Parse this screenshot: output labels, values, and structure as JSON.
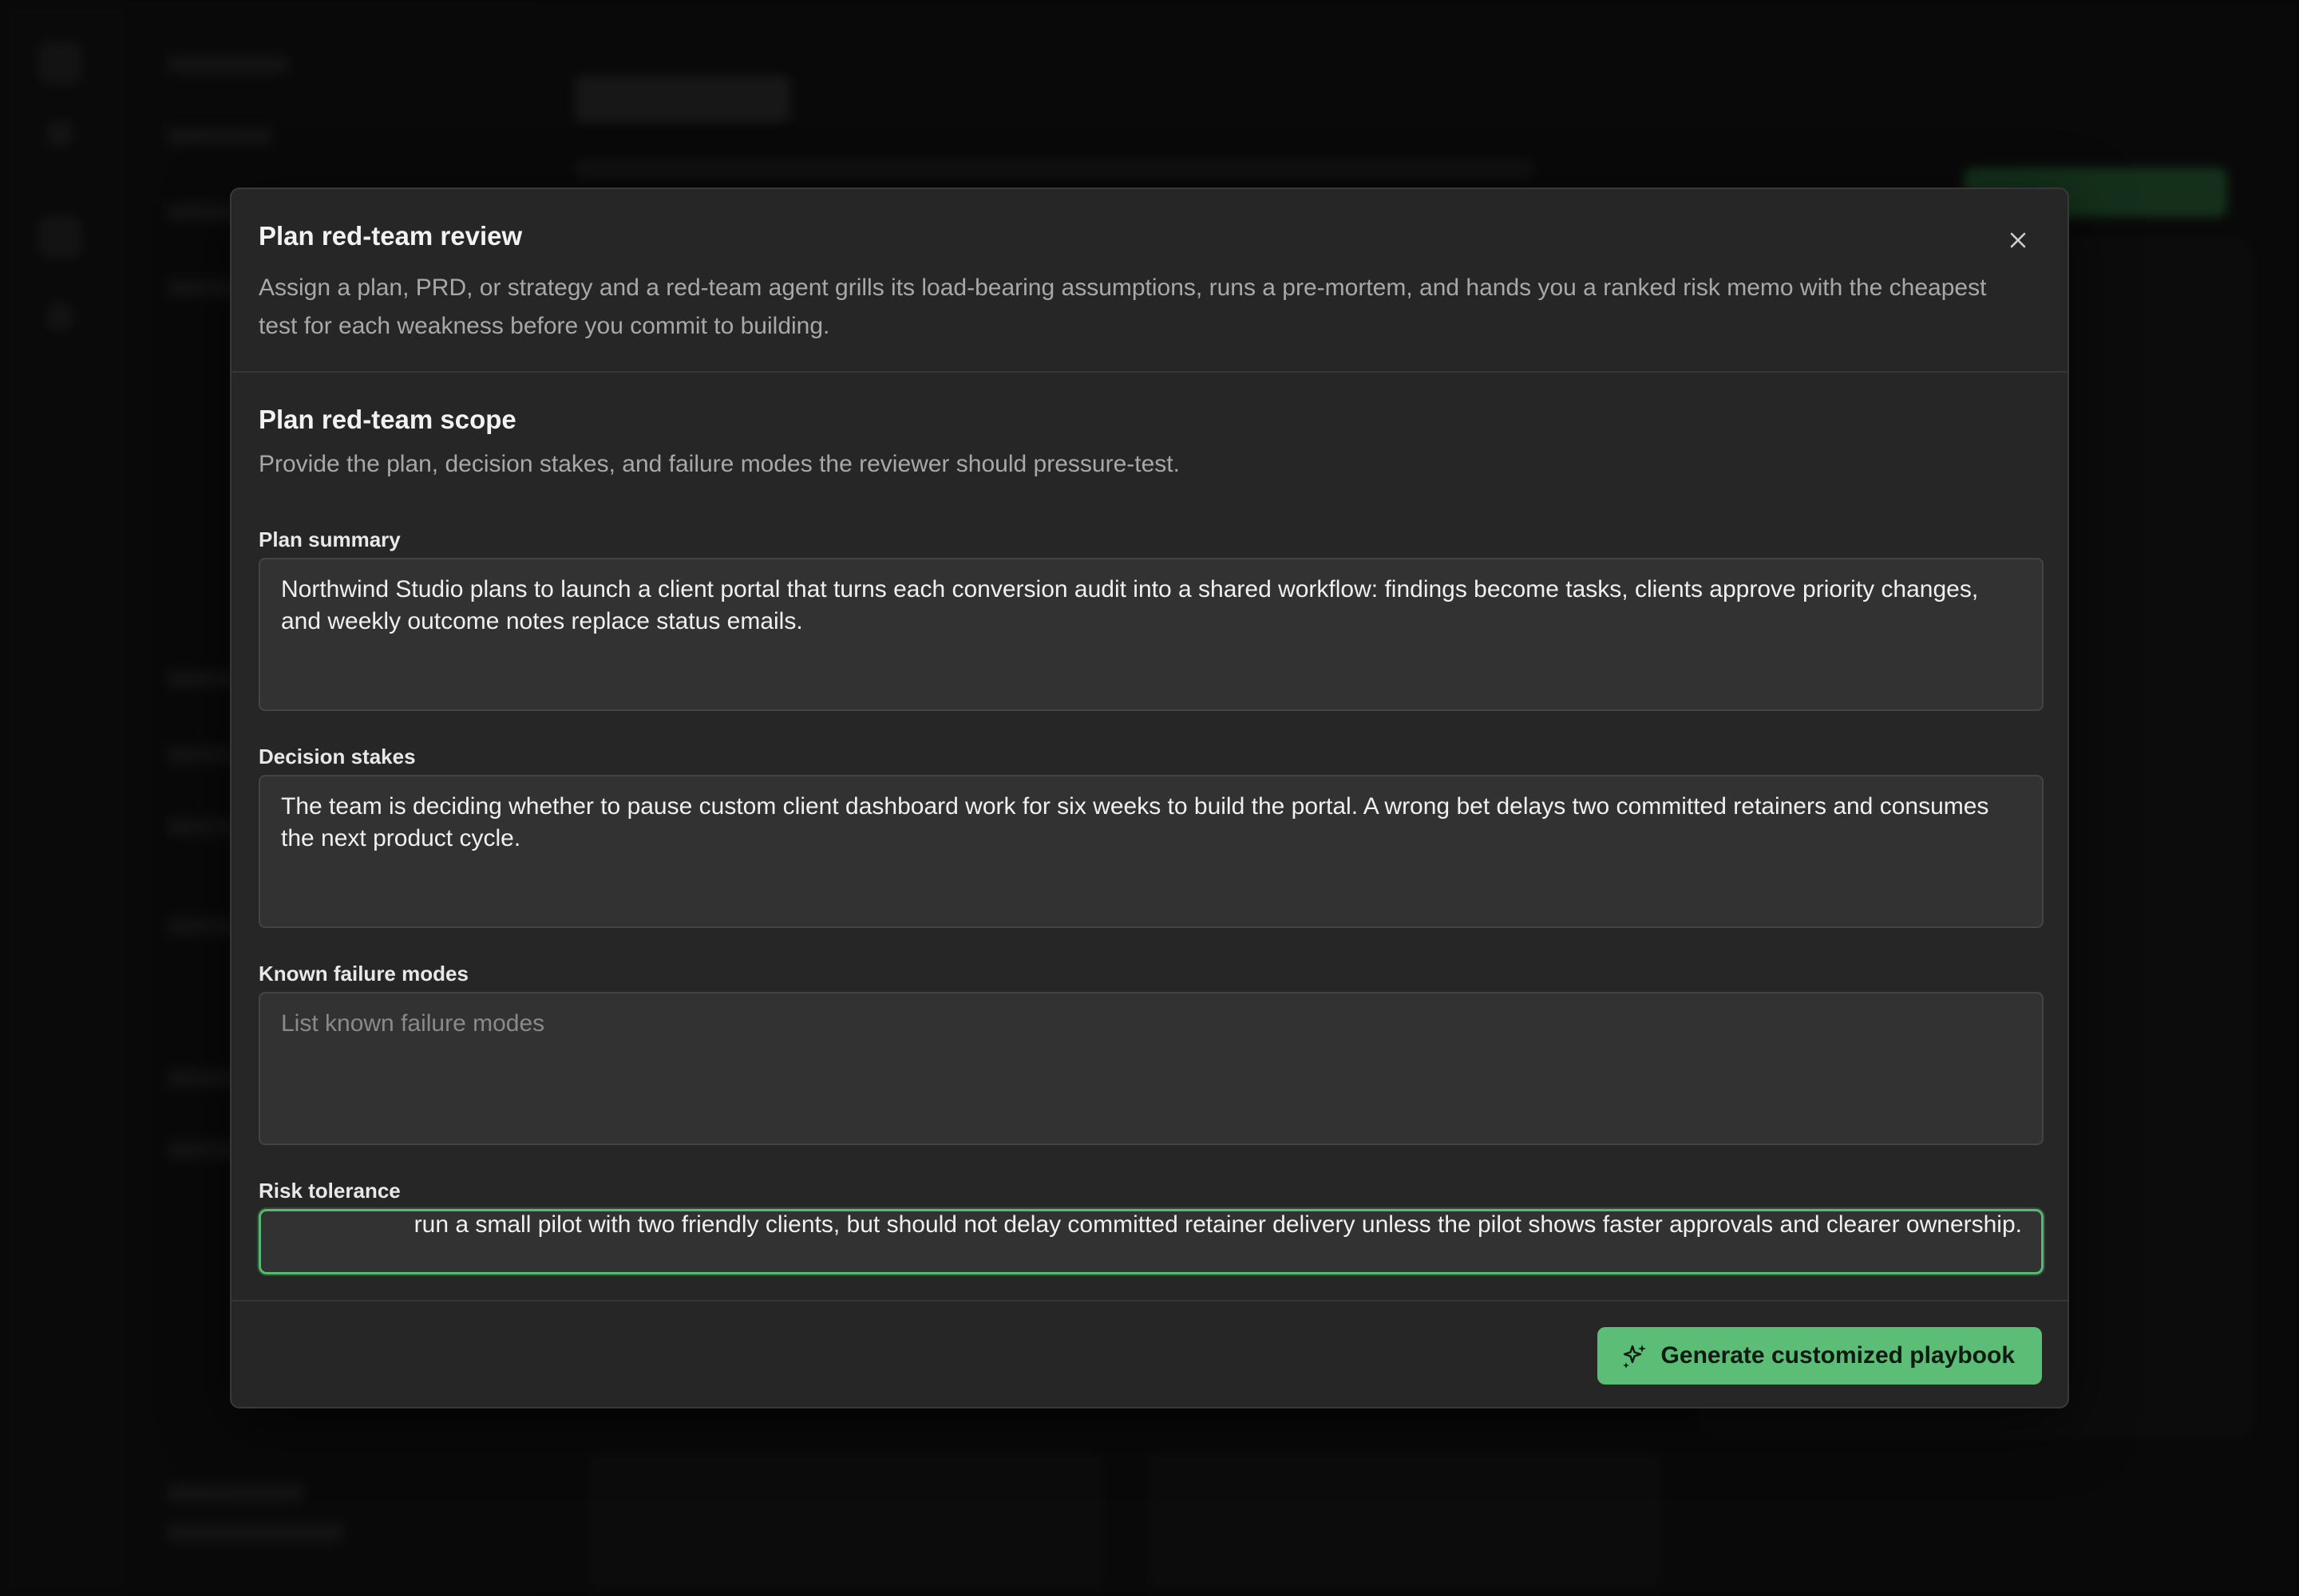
{
  "modal": {
    "title": "Plan red-team review",
    "description": "Assign a plan, PRD, or strategy and a red-team agent grills its load-bearing assumptions, runs a pre-mortem, and hands you a ranked risk memo with the cheapest test for each weakness before you commit to building.",
    "close_icon": "close-icon"
  },
  "scope": {
    "title": "Plan red-team scope",
    "description": "Provide the plan, decision stakes, and failure modes the reviewer should pressure-test."
  },
  "fields": {
    "plan_summary": {
      "label": "Plan summary",
      "value": "Northwind Studio plans to launch a client portal that turns each conversion audit into a shared workflow: findings become tasks, clients approve priority changes, and weekly outcome notes replace status emails."
    },
    "decision_stakes": {
      "label": "Decision stakes",
      "value": "The team is deciding whether to pause custom client dashboard work for six weeks to build the portal. A wrong bet delays two committed retainers and consumes the next product cycle."
    },
    "known_failure_modes": {
      "label": "Known failure modes",
      "value": "",
      "placeholder": "List known failure modes"
    },
    "risk_tolerance": {
      "label": "Risk tolerance",
      "value": "run a small pilot with two friendly clients, but should not delay committed retainer delivery unless the pilot shows faster approvals and clearer ownership."
    }
  },
  "footer": {
    "generate_label": "Generate customized playbook",
    "generate_icon": "sparkles-icon"
  },
  "colors": {
    "accent": "#5cbd76",
    "modal_bg": "#262626",
    "field_bg": "#323232"
  }
}
